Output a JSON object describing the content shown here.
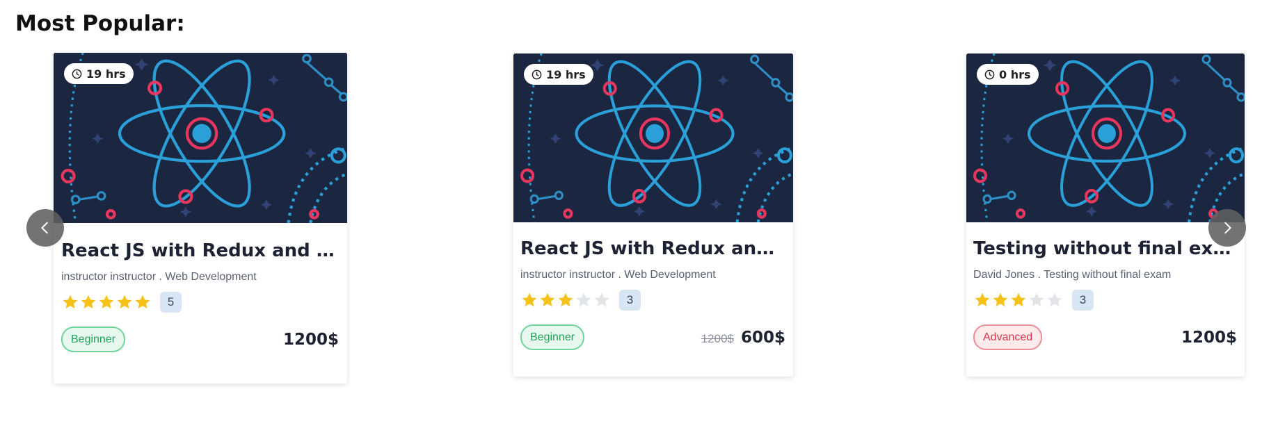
{
  "section": {
    "title": "Most Popular:"
  },
  "colors": {
    "star_filled": "#f6c21a",
    "star_empty": "#e3e4e8",
    "beginner": "#23a35a",
    "advanced": "#d9364a",
    "media_bg": "#1b2640",
    "atom_blue": "#2a9fd8",
    "atom_pink": "#e8375f"
  },
  "icons": {
    "duration": "clock-icon",
    "prev": "chevron-left-icon",
    "next": "chevron-right-icon",
    "star": "star-icon"
  },
  "carousel": {
    "prev_label": "‹",
    "next_label": "›"
  },
  "courses": [
    {
      "duration": "19 hrs",
      "title": "React JS with Redux and ho...",
      "meta": "instructor instructor . Web Development",
      "rating": 5,
      "rating_count": "5",
      "level": "Beginner",
      "old_price": "",
      "price": "1200$"
    },
    {
      "duration": "19 hrs",
      "title": "React JS with Redux and ho...",
      "meta": "instructor instructor . Web Development",
      "rating": 3,
      "rating_count": "3",
      "level": "Beginner",
      "old_price": "1200$",
      "price": "600$"
    },
    {
      "duration": "0 hrs",
      "title": "Testing without final exam",
      "meta": "David Jones . Testing without final exam",
      "rating": 3,
      "rating_count": "3",
      "level": "Advanced",
      "old_price": "",
      "price": "1200$"
    }
  ]
}
